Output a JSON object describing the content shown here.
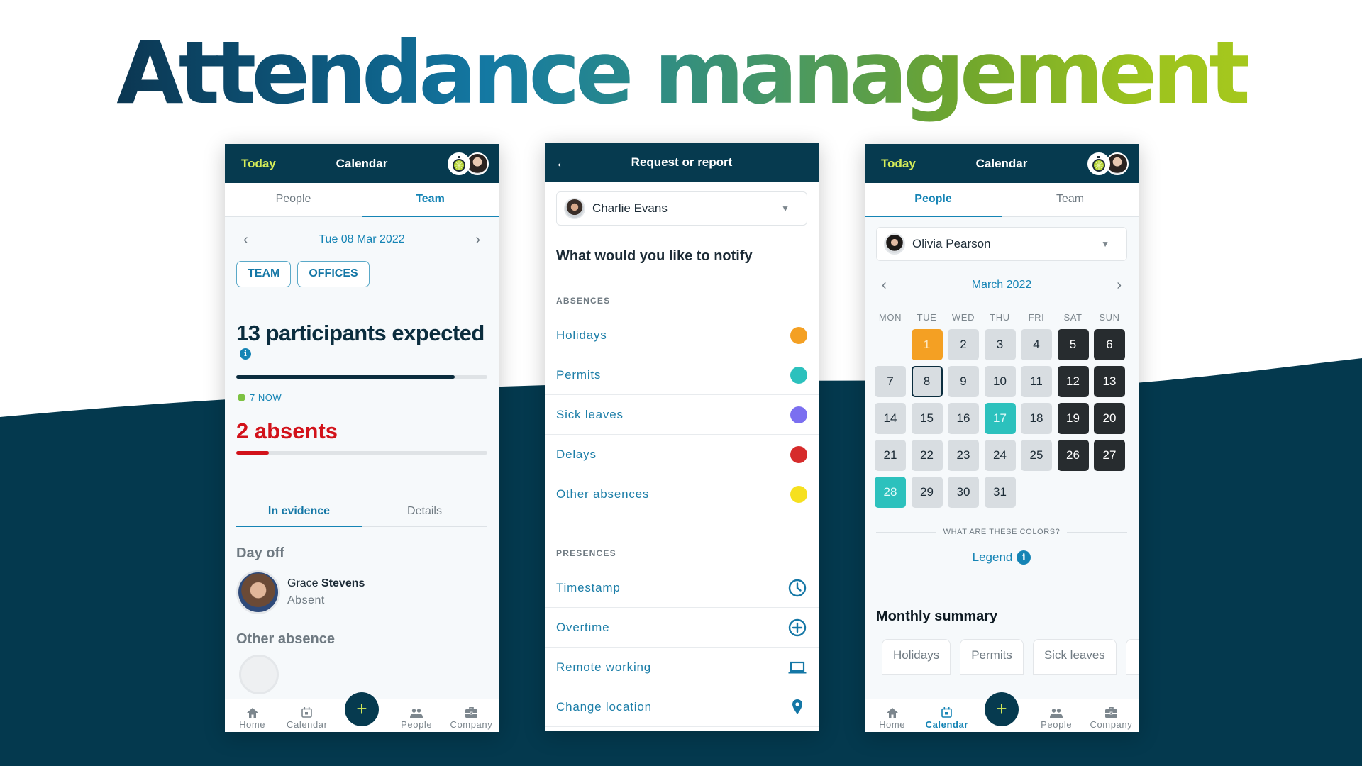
{
  "headline": "Attendance management",
  "colors": {
    "navy": "#063a4f",
    "accent_blue": "#1584b5",
    "lime": "#d5ec58",
    "red": "#d2121a",
    "holiday_orange": "#f4a023",
    "permit_teal": "#2cc1bd",
    "sick_purple": "#7b6ff0",
    "delay_red": "#d62b2b",
    "other_yellow": "#f6e01f",
    "now_green": "#7dc242"
  },
  "phone1": {
    "header": {
      "today": "Today",
      "title": "Calendar"
    },
    "tabs": [
      {
        "label": "People",
        "active": false
      },
      {
        "label": "Team",
        "active": true
      }
    ],
    "date": "Tue 08 Mar 2022",
    "filters": [
      "TEAM",
      "OFFICES"
    ],
    "participants_title": "13 participants expected",
    "participants_progress": 0.87,
    "now_label": "7 NOW",
    "absents_title": "2 absents",
    "absents_progress": 0.13,
    "subtabs": [
      {
        "label": "In evidence",
        "active": true
      },
      {
        "label": "Details",
        "active": false
      }
    ],
    "sections": {
      "day_off": "Day off",
      "other_absence": "Other absence"
    },
    "person": {
      "first_name": "Grace",
      "last_name": "Stevens",
      "status": "Absent"
    },
    "nav": [
      {
        "label": "Home",
        "icon": "home-icon",
        "active": false
      },
      {
        "label": "Calendar",
        "icon": "calendar-icon",
        "active": false
      },
      {
        "label": "People",
        "icon": "people-icon",
        "active": false
      },
      {
        "label": "Company",
        "icon": "briefcase-icon",
        "active": false
      }
    ],
    "fab": "+"
  },
  "phone2": {
    "header": {
      "back": "←",
      "title": "Request or report"
    },
    "selected_person": "Charlie Evans",
    "question": "What would you like to notify",
    "absences_label": "ABSENCES",
    "absences": [
      {
        "label": "Holidays",
        "color": "#f4a023"
      },
      {
        "label": "Permits",
        "color": "#2cc1bd"
      },
      {
        "label": "Sick leaves",
        "color": "#7b6ff0"
      },
      {
        "label": "Delays",
        "color": "#d62b2b"
      },
      {
        "label": "Other absences",
        "color": "#f6e01f"
      }
    ],
    "presences_label": "PRESENCES",
    "presences": [
      {
        "label": "Timestamp",
        "icon": "clock-icon"
      },
      {
        "label": "Overtime",
        "icon": "plus-circle-icon"
      },
      {
        "label": "Remote working",
        "icon": "laptop-icon"
      },
      {
        "label": "Change location",
        "icon": "location-pin-icon"
      }
    ]
  },
  "phone3": {
    "header": {
      "today": "Today",
      "title": "Calendar"
    },
    "tabs": [
      {
        "label": "People",
        "active": true
      },
      {
        "label": "Team",
        "active": false
      }
    ],
    "selected_person": "Olivia Pearson",
    "month": "March 2022",
    "weekdays": [
      "MON",
      "TUE",
      "WED",
      "THU",
      "FRI",
      "SAT",
      "SUN"
    ],
    "first_weekday_offset": 1,
    "days": [
      {
        "d": "1",
        "type": "holiday"
      },
      {
        "d": "2",
        "type": "work"
      },
      {
        "d": "3",
        "type": "work"
      },
      {
        "d": "4",
        "type": "work"
      },
      {
        "d": "5",
        "type": "weekend"
      },
      {
        "d": "6",
        "type": "weekend"
      },
      {
        "d": "7",
        "type": "work"
      },
      {
        "d": "8",
        "type": "today"
      },
      {
        "d": "9",
        "type": "work"
      },
      {
        "d": "10",
        "type": "work"
      },
      {
        "d": "11",
        "type": "work"
      },
      {
        "d": "12",
        "type": "weekend"
      },
      {
        "d": "13",
        "type": "weekend"
      },
      {
        "d": "14",
        "type": "work"
      },
      {
        "d": "15",
        "type": "work"
      },
      {
        "d": "16",
        "type": "work"
      },
      {
        "d": "17",
        "type": "permit"
      },
      {
        "d": "18",
        "type": "work"
      },
      {
        "d": "19",
        "type": "weekend"
      },
      {
        "d": "20",
        "type": "weekend"
      },
      {
        "d": "21",
        "type": "work"
      },
      {
        "d": "22",
        "type": "work"
      },
      {
        "d": "23",
        "type": "work"
      },
      {
        "d": "24",
        "type": "work"
      },
      {
        "d": "25",
        "type": "work"
      },
      {
        "d": "26",
        "type": "weekend"
      },
      {
        "d": "27",
        "type": "weekend"
      },
      {
        "d": "28",
        "type": "permit"
      },
      {
        "d": "29",
        "type": "work"
      },
      {
        "d": "30",
        "type": "work"
      },
      {
        "d": "31",
        "type": "work"
      }
    ],
    "colors_question": "WHAT ARE THESE COLORS?",
    "legend_label": "Legend",
    "summary_title": "Monthly summary",
    "summary_chips": [
      "Holidays",
      "Permits",
      "Sick leaves",
      ""
    ],
    "nav": [
      {
        "label": "Home",
        "icon": "home-icon",
        "active": false
      },
      {
        "label": "Calendar",
        "icon": "calendar-icon",
        "active": true
      },
      {
        "label": "People",
        "icon": "people-icon",
        "active": false
      },
      {
        "label": "Company",
        "icon": "briefcase-icon",
        "active": false
      }
    ],
    "fab": "+"
  }
}
